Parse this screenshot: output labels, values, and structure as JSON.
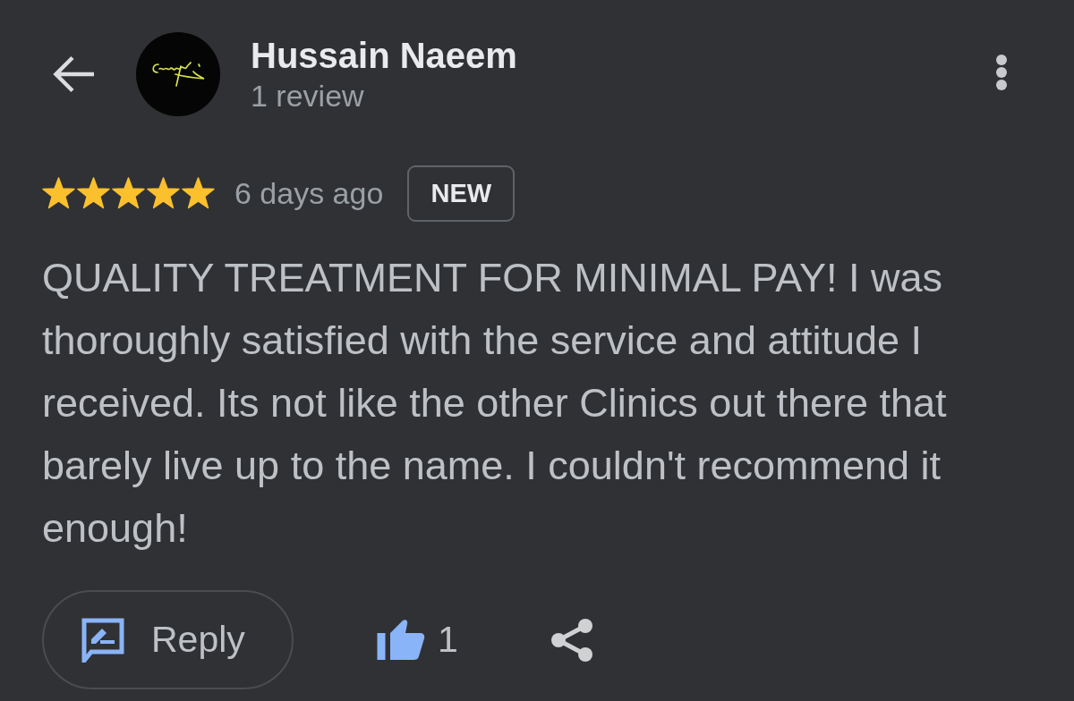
{
  "header": {
    "name": "Hussain Naeem",
    "subtitle": "1 review"
  },
  "review": {
    "stars": 5,
    "time": "6 days ago",
    "badge": "NEW",
    "text": "QUALITY TREATMENT FOR MINIMAL PAY! I was thoroughly satisfied with the service and attitude I received. Its not like the other Clinics out there that barely live up to the name. I couldn't recommend it enough!"
  },
  "actions": {
    "reply": "Reply",
    "likes": "1",
    "liked": true
  }
}
